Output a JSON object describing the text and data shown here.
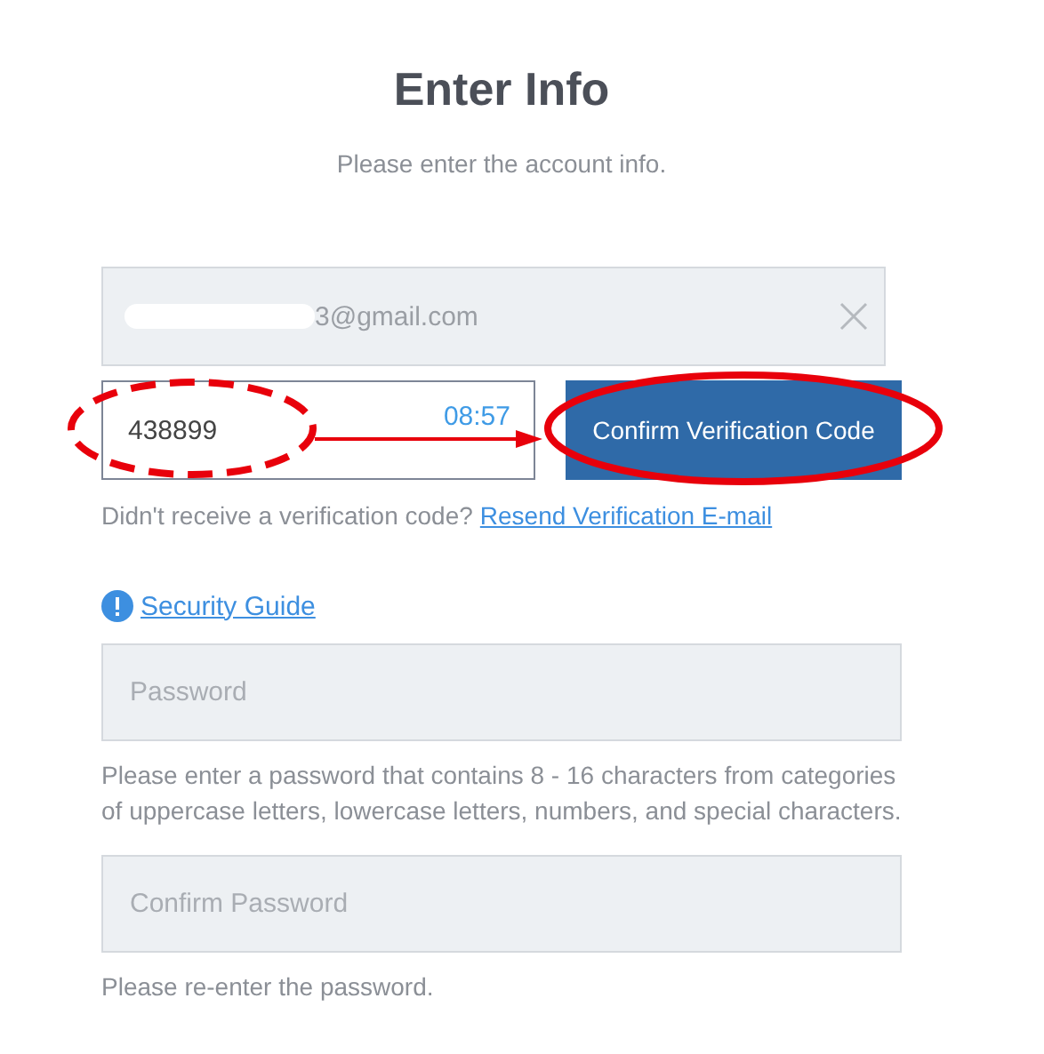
{
  "title": "Enter Info",
  "subtitle": "Please enter the account info.",
  "email": {
    "value": "3@gmail.com",
    "redacted": true
  },
  "code": {
    "value": "438899",
    "timer": "08:57",
    "button": "Confirm Verification Code"
  },
  "resend": {
    "prompt": "Didn't receive a verification code?",
    "link": "Resend Verification E-mail"
  },
  "security_link": "Security Guide",
  "password_fields": [
    {
      "placeholder": "Password",
      "hint": "Please enter a password that contains 8 - 16 characters from categories of uppercase letters, lowercase letters, numbers, and special characters."
    },
    {
      "placeholder": "Confirm Password",
      "hint": "Please re-enter the password."
    }
  ]
}
